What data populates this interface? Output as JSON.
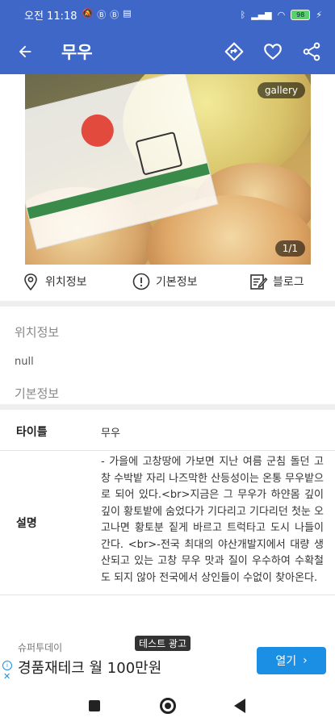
{
  "status_bar": {
    "time": "오전 11:18",
    "battery": "98"
  },
  "app_bar": {
    "title": "무우",
    "icons": [
      "back-arrow-icon",
      "directions-icon",
      "heart-icon",
      "share-icon"
    ]
  },
  "gallery": {
    "label": "gallery",
    "counter": "1/1"
  },
  "tabs": [
    {
      "label": "위치정보",
      "icon": "location-pin-icon"
    },
    {
      "label": "기본정보",
      "icon": "info-circle-icon"
    },
    {
      "label": "블로그",
      "icon": "blog-edit-icon"
    }
  ],
  "sections": {
    "location_heading": "위치정보",
    "location_value": "null",
    "basic_heading": "기본정보"
  },
  "details": {
    "title_label": "타이틀",
    "title_value": "무우",
    "desc_label": "설명",
    "desc_value": "- 가을에 고창땅에 가보면 지난 여름 군침 돌던 고창 수박밭 자리 나즈막한 산등성이는 온통 무우밭으로 되어 있다.<br>지금은 그 무우가 하얀몸 깊이 깊이 황토밭에 숨었다가 기다리고 기다리던 첫눈 오고나면 황토분 짙게 바르고 트럭타고 도시 나들이 간다. <br>-전국 최대의 야산개발지에서 대량 생산되고 있는 고창 무우 맛과 질이 우수하여 수확철도 되지 않아 전국에서 상인들이 수없이 찾아온다."
  },
  "ad": {
    "sponsor": "슈퍼투데이",
    "badge": "테스트 광고",
    "headline": "경품재테크 월 100만원",
    "button": "열기"
  },
  "colors": {
    "primary": "#3f67c8",
    "ad_button": "#1a8fe3"
  }
}
